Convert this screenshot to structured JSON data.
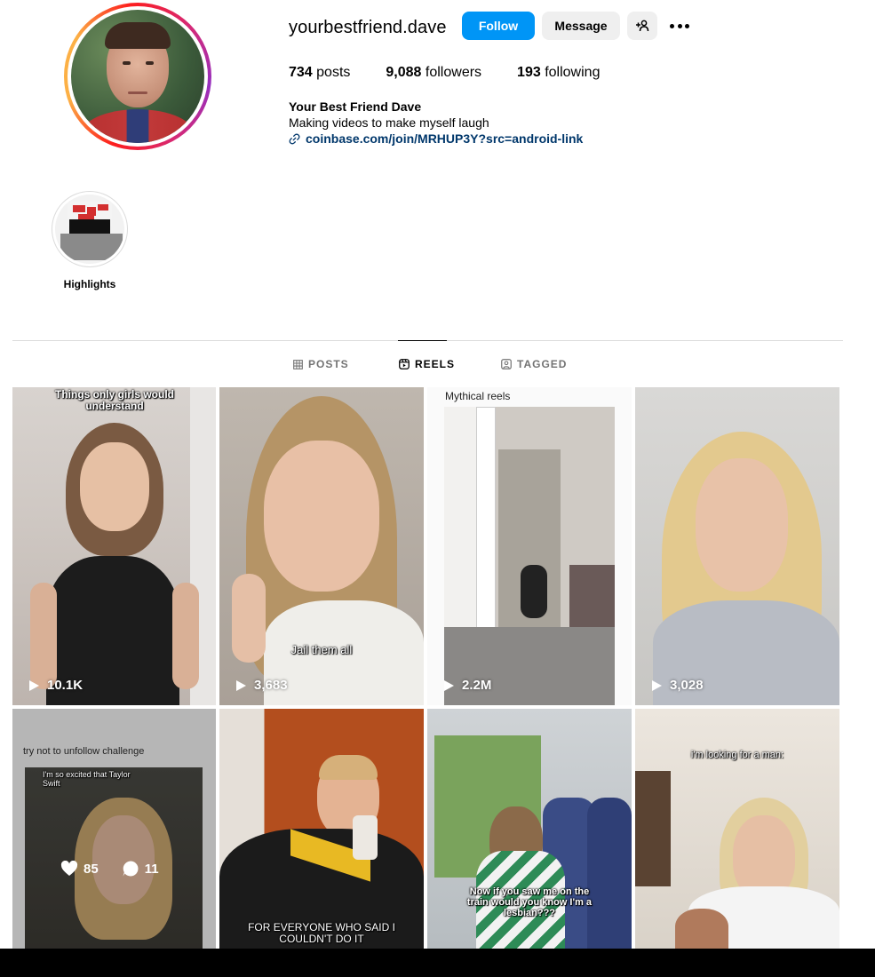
{
  "profile": {
    "username": "yourbestfriend.dave",
    "follow_label": "Follow",
    "message_label": "Message",
    "posts_count": "734",
    "posts_label": "posts",
    "followers_count": "9,088",
    "followers_label": "followers",
    "following_count": "193",
    "following_label": "following",
    "full_name": "Your Best Friend Dave",
    "bio": "Making videos to make myself laugh",
    "link": "coinbase.com/join/MRHUP3Y?src=android-link"
  },
  "highlights": [
    {
      "label": "Highlights"
    }
  ],
  "tabs": [
    {
      "label": "POSTS",
      "icon": "grid-icon",
      "active": false
    },
    {
      "label": "REELS",
      "icon": "reels-icon",
      "active": true
    },
    {
      "label": "TAGGED",
      "icon": "tagged-icon",
      "active": false
    }
  ],
  "reels": [
    {
      "caption": "Things only girls would understand",
      "views": "10.1K"
    },
    {
      "caption": "Jail them all",
      "views": "3,683"
    },
    {
      "caption": "Mythical reels",
      "views": "2.2M"
    },
    {
      "caption": "",
      "views": "3,028"
    },
    {
      "caption": "try not to unfollow challenge",
      "inner_caption": "I'm so excited that Taylor Swift",
      "likes": "85",
      "comments": "11"
    },
    {
      "caption": "FOR EVERYONE WHO SAID I COULDN'T DO IT"
    },
    {
      "caption": "Now if you saw me on the train would you know I'm a lesbian???"
    },
    {
      "caption": "i'm looking for a man:"
    }
  ],
  "colors": {
    "follow_button": "#0095f6",
    "secondary_button": "#efefef",
    "link": "#00376b",
    "muted": "#737373"
  }
}
